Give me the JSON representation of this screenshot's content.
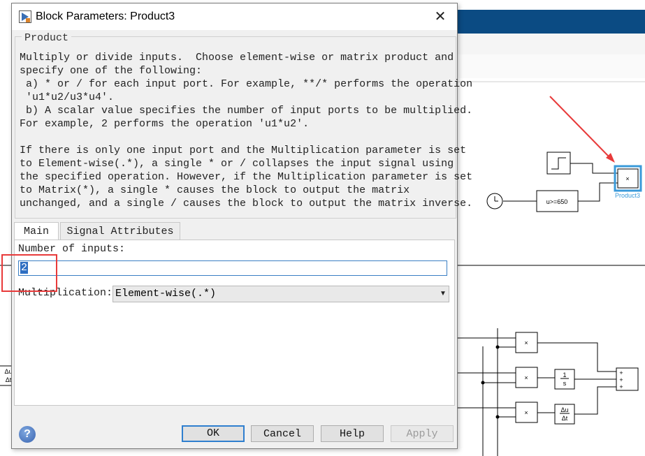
{
  "dialog": {
    "title": "Block Parameters: Product3",
    "close_glyph": "✕",
    "block_name": "Product",
    "description_lines": [
      "Multiply or divide inputs.  Choose element-wise or matrix product and",
      "specify one of the following:",
      " a) * or / for each input port. For example, **/* performs the operation",
      " 'u1*u2/u3*u4'.",
      " b) A scalar value specifies the number of input ports to be multiplied.",
      "For example, 2 performs the operation 'u1*u2'.",
      "",
      "If there is only one input port and the Multiplication parameter is set",
      "to Element-wise(.*), a single * or / collapses the input signal using",
      "the specified operation. However, if the Multiplication parameter is set",
      "to Matrix(*), a single * causes the block to output the matrix",
      "unchanged, and a single / causes the block to output the matrix inverse."
    ],
    "tabs": [
      {
        "label": "Main",
        "active": true
      },
      {
        "label": "Signal Attributes",
        "active": false
      }
    ],
    "number_of_inputs_label": "Number of inputs:",
    "number_of_inputs_value": "2",
    "multiplication_label": "Multiplication:",
    "multiplication_value": "Element-wise(.*)",
    "buttons": {
      "ok": "OK",
      "cancel": "Cancel",
      "help": "Help",
      "apply": "Apply"
    },
    "help_icon_glyph": "?"
  },
  "model": {
    "blocks": {
      "product_glyph": "×",
      "selected_block_label": "Product3",
      "relational_label": "u>=650",
      "integrator_num": "1",
      "integrator_den": "s",
      "derivative_num": "Δu",
      "derivative_den": "Δt",
      "sum_signs": [
        "+",
        "+",
        "+"
      ]
    }
  },
  "colors": {
    "titlebar_bg": "#0b4b83",
    "selection_blue": "#3a9ad9",
    "annotation_red": "#e83a3a",
    "focus_blue": "#2f7fcf"
  }
}
